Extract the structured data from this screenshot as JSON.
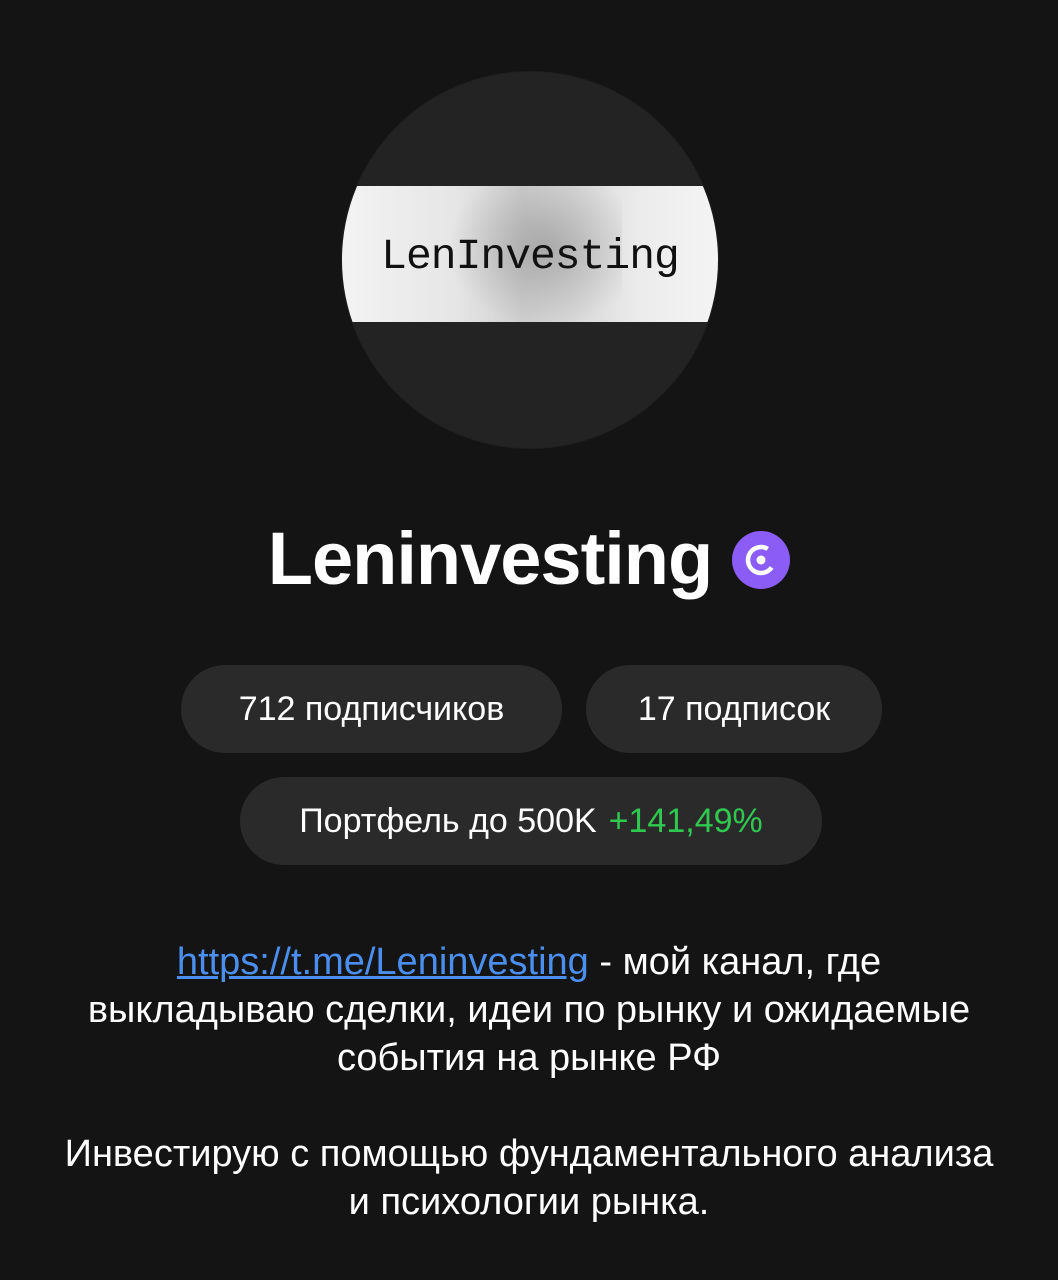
{
  "avatar": {
    "logo_text": "LenInvesting"
  },
  "profile": {
    "name": "Leninvesting",
    "badge_icon": "verified-author-icon",
    "badge_color": "#8b5cf6"
  },
  "stats": {
    "followers": "712 подписчиков",
    "following": "17 подписок"
  },
  "portfolio": {
    "label": "Портфель до 500K",
    "gain": "+141,49%",
    "gain_color": "#2fc94f"
  },
  "bio": {
    "link": "https://t.me/Leninvesting",
    "link_color": "#4a8ff0",
    "line1_suffix": " - мой канал, где выкладываю сделки, идеи по рынку и ожидаемые события на рынке РФ",
    "paragraph2": "Инвестирую с помощью фундаментального анализа и психологии рынка."
  }
}
